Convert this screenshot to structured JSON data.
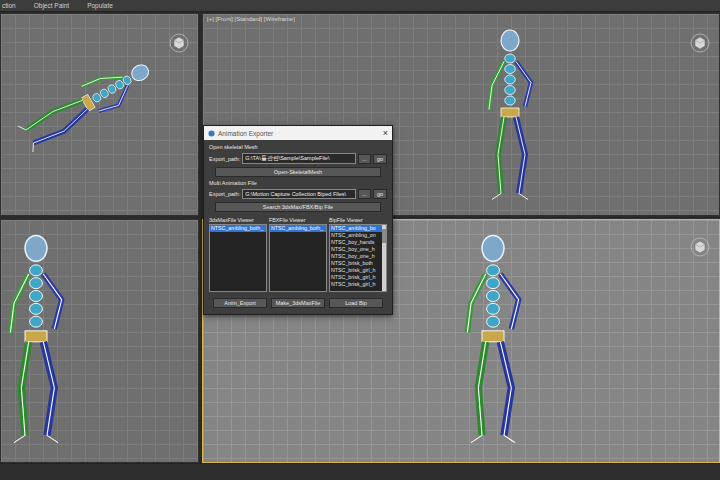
{
  "menu_bar": {
    "items": [
      "ction",
      "Object Paint",
      "Populate"
    ]
  },
  "viewports": [
    {
      "name": "top-left",
      "active": false
    },
    {
      "name": "top-right",
      "active": false,
      "label": "[+] [Front] [Standard] [Wireframe]"
    },
    {
      "name": "bottom-left",
      "active": false
    },
    {
      "name": "bottom-right",
      "active": true
    }
  ],
  "dialog": {
    "title": "Animation Exporter",
    "close": "×",
    "sections": [
      {
        "heading": "Open skeletal Mesh",
        "path_label": "Export_path:",
        "path": "G:\\TA\\툴관련\\Sample\\SampleFile\\",
        "browse": "...",
        "go": "go",
        "action": "Open-SkeletalMesh"
      },
      {
        "heading": "Multi Animation File",
        "path_label": "Export_path:",
        "path": "G:\\Motion Capture Collection Biped Files\\",
        "browse": "...",
        "go": "go",
        "action": "Search 3dsMax/FBX/Bip File"
      }
    ],
    "lists": [
      {
        "header": "3dsMaxFile Viewer",
        "scrollable": false,
        "items": [
          {
            "text": "NTSC_ambling_both_",
            "selected": true
          }
        ]
      },
      {
        "header": "FBXFile Viewer",
        "scrollable": false,
        "items": [
          {
            "text": "NTSC_ambling_both_",
            "selected": true
          }
        ]
      },
      {
        "header": "BipFile Viewer",
        "scrollable": true,
        "items": [
          {
            "text": "NTSC_ambling_bo",
            "selected": true
          },
          {
            "text": "NTSC_ambling_on",
            "selected": false
          },
          {
            "text": "NTSC_boy_hands",
            "selected": false
          },
          {
            "text": "NTSC_boy_one_h",
            "selected": false
          },
          {
            "text": "NTSC_boy_one_h",
            "selected": false
          },
          {
            "text": "NTSC_brisk_both",
            "selected": false
          },
          {
            "text": "NTSC_brisk_girl_h",
            "selected": false
          },
          {
            "text": "NTSC_brisk_girl_h",
            "selected": false
          },
          {
            "text": "NTSC_brisk_girl_h",
            "selected": false
          }
        ]
      }
    ],
    "buttons": [
      "Anim_Export",
      "Make_3dsMaxFile",
      "Load Bip"
    ]
  }
}
